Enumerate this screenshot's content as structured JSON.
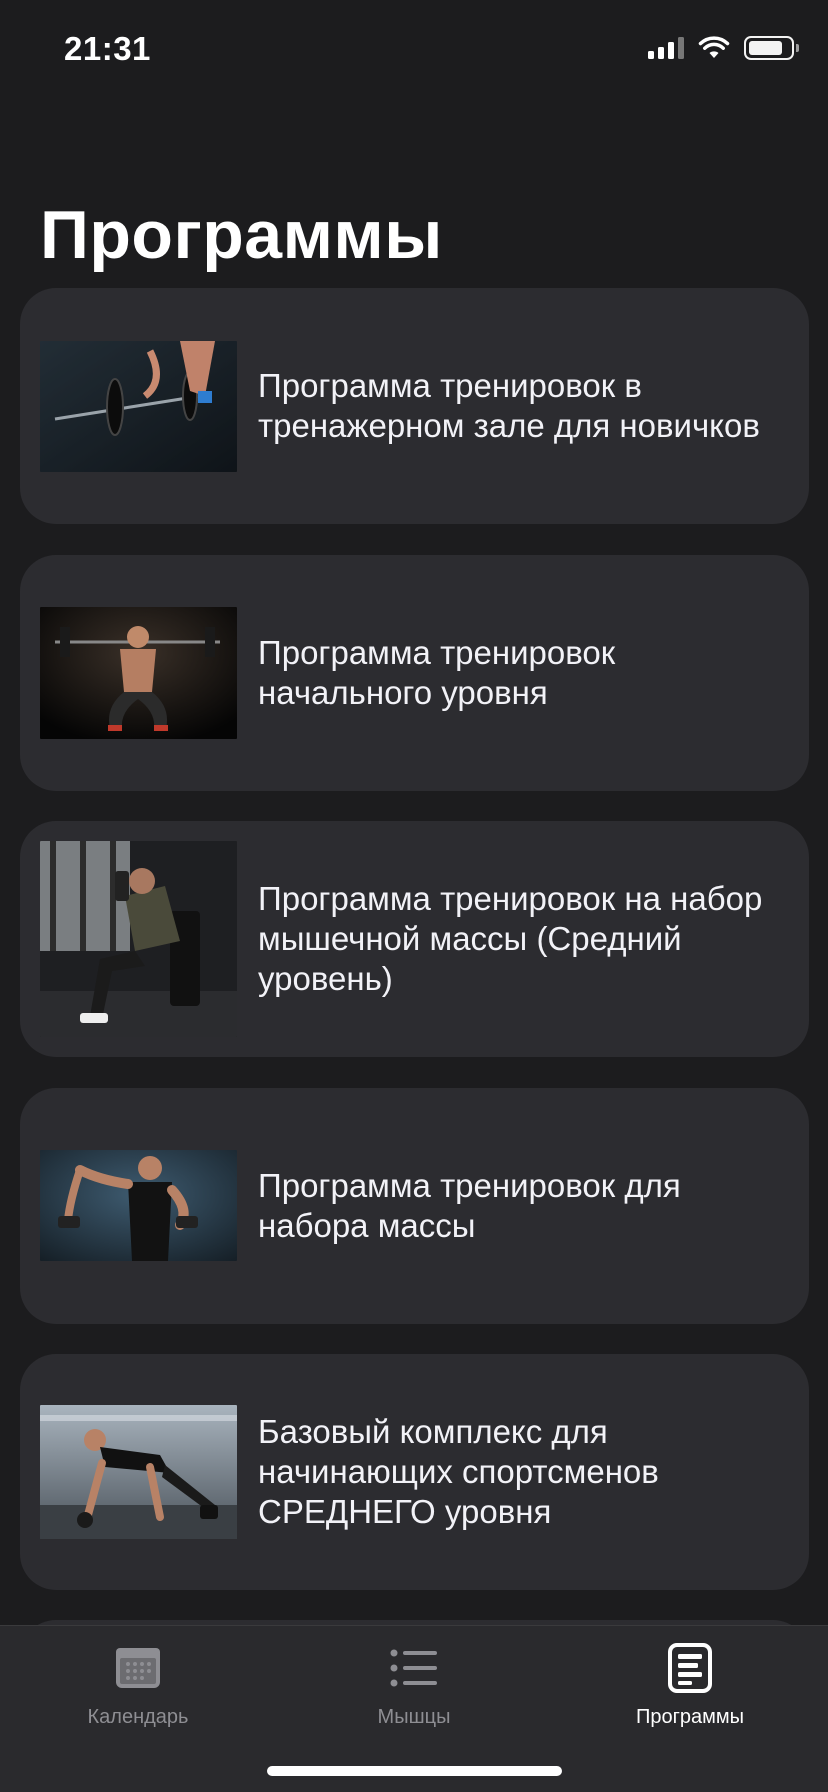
{
  "status_bar": {
    "time": "21:31"
  },
  "page": {
    "title": "Программы"
  },
  "programs": [
    {
      "name": "Программа тренировок в тренажерном зале для новичков",
      "image_icon": "barbell-photo"
    },
    {
      "name": "Программа тренировок начального уровня",
      "image_icon": "squat-photo"
    },
    {
      "name": "Программа тренировок на набор мышечной массы (Средний уровень)",
      "image_icon": "dumbbell-curl-photo"
    },
    {
      "name": "Программа тренировок для набора массы",
      "image_icon": "dumbbell-curls-standing-photo"
    },
    {
      "name": "Базовый комплекс для начинающих спортсменов СРЕДНЕГО уровня",
      "image_icon": "plank-kettlebell-photo"
    }
  ],
  "tab_bar": {
    "tabs": [
      {
        "label": "Календарь",
        "icon": "calendar-icon",
        "active": false
      },
      {
        "label": "Мышцы",
        "icon": "list-icon",
        "active": false
      },
      {
        "label": "Программы",
        "icon": "document-icon",
        "active": true
      }
    ]
  },
  "colors": {
    "background": "#1c1c1e",
    "card": "#2c2c30",
    "tab_inactive": "#8e8e93",
    "tab_active": "#ffffff"
  }
}
